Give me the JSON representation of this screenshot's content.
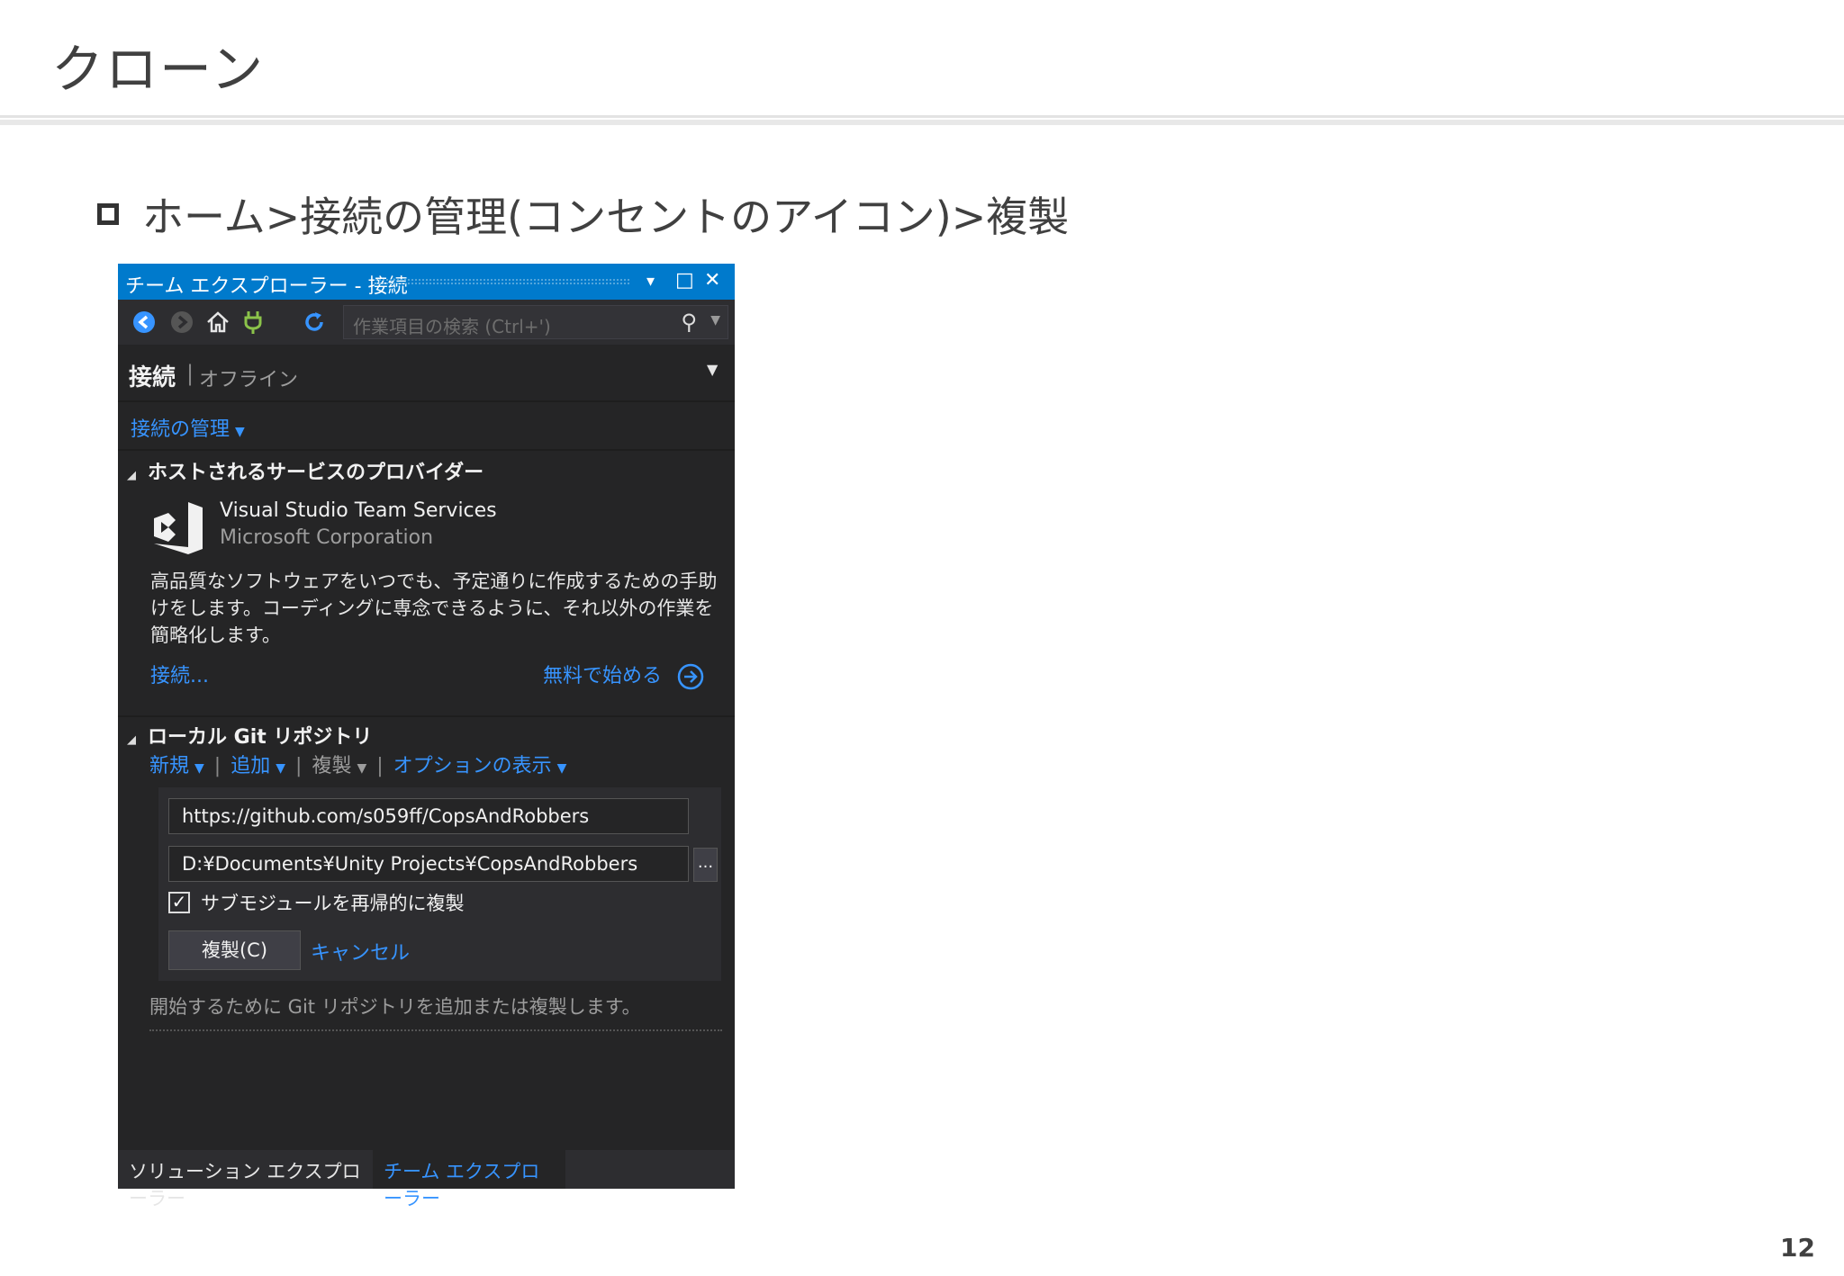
{
  "slide": {
    "title": "クローン",
    "bullet": "ホーム>接続の管理(コンセントのアイコン)>複製",
    "page_number": "12"
  },
  "panel": {
    "title": "チーム エクスプローラー - 接続",
    "title_buttons": {
      "dropdown": "▾",
      "maximize": "□",
      "close": "✕"
    },
    "toolbar": {
      "back_icon": "back-icon",
      "forward_icon": "forward-icon",
      "home_icon": "home-icon",
      "connect_icon": "plug-icon",
      "refresh_icon": "refresh-icon",
      "search_placeholder": "作業項目の検索 (Ctrl+')"
    },
    "header": {
      "title": "接続",
      "divider": "|",
      "status": "オフライン"
    },
    "manage_connections": "接続の管理",
    "hosted_section": {
      "title": "ホストされるサービスのプロバイダー",
      "provider_name": "Visual Studio Team Services",
      "provider_company": "Microsoft Corporation",
      "description": "高品質なソフトウェアをいつでも、予定通りに作成するための手助けをします。コーディングに専念できるように、それ以外の作業を簡略化します。",
      "connect_link": "接続...",
      "free_link": "無料で始める"
    },
    "git_section": {
      "title": "ローカル Git リポジトリ",
      "actions": [
        {
          "label": "新規",
          "enabled": true
        },
        {
          "label": "追加",
          "enabled": true
        },
        {
          "label": "複製",
          "enabled": false
        },
        {
          "label": "オプションの表示",
          "enabled": true
        }
      ],
      "url_value": "https://github.com/s059ff/CopsAndRobbers",
      "path_value": "D:¥Documents¥Unity Projects¥CopsAndRobbers",
      "browse_label": "...",
      "submodule_label": "サブモジュールを再帰的に複製",
      "submodule_checked": true,
      "clone_button": "複製(C)",
      "cancel_link": "キャンセル",
      "hint": "開始するために Git リポジトリを追加または複製します。"
    },
    "tabs": [
      {
        "label": "ソリューション エクスプローラー",
        "active": false
      },
      {
        "label": "チーム エクスプローラー",
        "active": true
      }
    ],
    "colors": {
      "accent": "#007acc",
      "link": "#3794ff",
      "background": "#252526"
    }
  }
}
